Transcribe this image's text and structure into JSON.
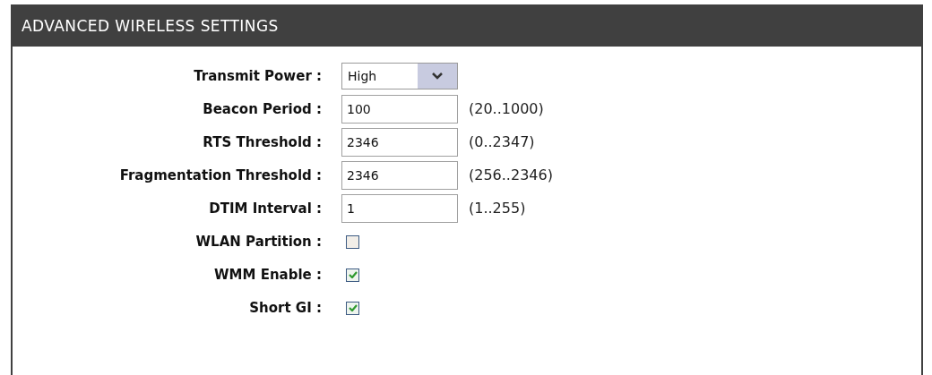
{
  "panel": {
    "title": "ADVANCED WIRELESS SETTINGS"
  },
  "settings": [
    {
      "kind": "select",
      "label": "Transmit Power :",
      "value": "High"
    },
    {
      "kind": "text",
      "label": "Beacon Period :",
      "value": "100",
      "range": "(20..1000)"
    },
    {
      "kind": "text",
      "label": "RTS Threshold :",
      "value": "2346",
      "range": "(0..2347)"
    },
    {
      "kind": "text",
      "label": "Fragmentation Threshold :",
      "value": "2346",
      "range": "(256..2346)"
    },
    {
      "kind": "text",
      "label": "DTIM Interval :",
      "value": "1",
      "range": "(1..255)"
    },
    {
      "kind": "checkbox",
      "label": "WLAN Partition :",
      "checked": false
    },
    {
      "kind": "checkbox",
      "label": "WMM Enable :",
      "checked": true
    },
    {
      "kind": "checkbox",
      "label": "Short GI :",
      "checked": true
    }
  ]
}
